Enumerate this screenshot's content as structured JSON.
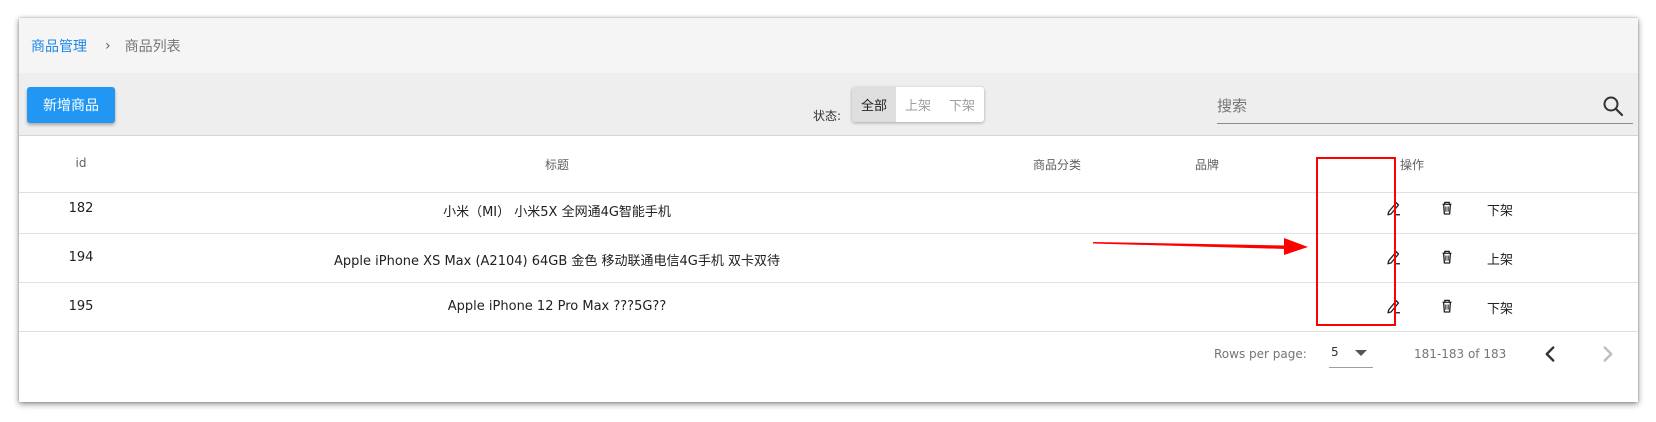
{
  "breadcrumb": {
    "parent": "商品管理",
    "separator": "›",
    "current": "商品列表"
  },
  "toolbar": {
    "add_label": "新增商品",
    "status_label": "状态:",
    "status_options": [
      "全部",
      "上架",
      "下架"
    ],
    "status_selected": "全部",
    "search_placeholder": "搜索"
  },
  "table": {
    "headers": {
      "id": "id",
      "title": "标题",
      "category": "商品分类",
      "brand": "品牌",
      "actions": "操作"
    },
    "rows": [
      {
        "id": "182",
        "title": "小米（MI） 小米5X 全网通4G智能手机",
        "category": "",
        "brand": "",
        "toggle": "下架"
      },
      {
        "id": "194",
        "title": "Apple iPhone XS Max (A2104) 64GB 金色 移动联通电信4G手机 双卡双待",
        "category": "",
        "brand": "",
        "toggle": "上架"
      },
      {
        "id": "195",
        "title": "Apple iPhone 12 Pro Max ???5G??",
        "category": "",
        "brand": "",
        "toggle": "下架"
      }
    ]
  },
  "footer": {
    "rows_per_page_label": "Rows per page:",
    "rows_per_page": "5",
    "range": "181-183 of 183"
  },
  "icons": {
    "edit": "pencil-icon",
    "delete": "trash-icon",
    "search": "search-icon",
    "prev": "chevron-left-icon",
    "next": "chevron-right-icon"
  },
  "colors": {
    "primary": "#2196f3",
    "link": "#1e88e5",
    "annotation": "#ff0000"
  }
}
